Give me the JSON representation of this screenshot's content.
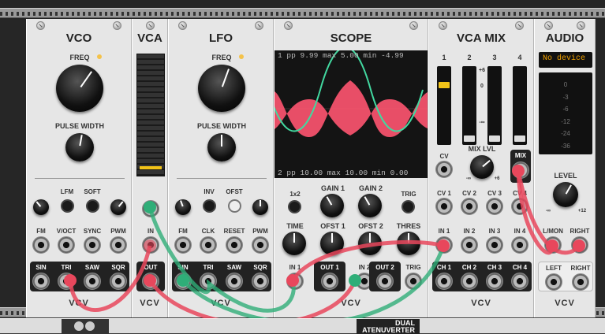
{
  "modules": {
    "vco": {
      "title": "VCO",
      "freq_label": "FREQ",
      "pw_label": "PULSE WIDTH",
      "lfm_label": "LFM",
      "soft_label": "SOFT",
      "inputs": [
        "FM",
        "V/OCT",
        "SYNC",
        "PWM"
      ],
      "outputs": [
        "SIN",
        "TRI",
        "SAW",
        "SQR"
      ],
      "brand": "VCV"
    },
    "vca": {
      "title": "VCA",
      "in_label": "IN",
      "out_label": "OUT",
      "brand": "VCV"
    },
    "lfo": {
      "title": "LFO",
      "freq_label": "FREQ",
      "pw_label": "PULSE WIDTH",
      "inv_label": "INV",
      "ofst_label": "OFST",
      "inputs": [
        "FM",
        "CLK",
        "RESET",
        "PWM"
      ],
      "outputs": [
        "SIN",
        "TRI",
        "SAW",
        "SQR"
      ],
      "brand": "VCV"
    },
    "scope": {
      "title": "SCOPE",
      "top_readout": {
        "channel": "1",
        "pp": "pp",
        "pp_val": "9.99",
        "max": "max",
        "max_val": "5.00",
        "min": "min",
        "min_val": "-4.99"
      },
      "bottom_readout": {
        "channel": "2",
        "pp": "pp",
        "pp_val": "10.00",
        "max": "max",
        "max_val": "10.00",
        "min": "min",
        "min_val": "0.00"
      },
      "x12_label": "1x2",
      "gain1": "GAIN 1",
      "gain2": "GAIN 2",
      "trig_label": "TRIG",
      "time_label": "TIME",
      "ofst1": "OFST 1",
      "ofst2": "OFST 2",
      "thres_label": "THRES",
      "ports": [
        "IN 1",
        "OUT 1",
        "IN 2",
        "OUT 2"
      ],
      "trig_in": "TRIG",
      "brand": "VCV"
    },
    "vcamix": {
      "title": "VCA MIX",
      "channels": [
        "1",
        "2",
        "3",
        "4"
      ],
      "scale_marks": [
        "+6",
        "0",
        "-∞"
      ],
      "cv_label": "CV",
      "mix_lvl_label": "MIX LVL",
      "mix_label": "MIX",
      "knob_min": "-∞",
      "knob_max": "+6",
      "cv_inputs": [
        "CV 1",
        "CV 2",
        "CV 3",
        "CV 4"
      ],
      "ins": [
        "IN 1",
        "IN 2",
        "IN 3",
        "IN 4"
      ],
      "outs": [
        "CH 1",
        "CH 2",
        "CH 3",
        "CH 4"
      ],
      "brand": "VCV"
    },
    "audio": {
      "title": "AUDIO",
      "device": "No device",
      "meter": [
        "0",
        "-3",
        "-6",
        "-12",
        "-24",
        "-36"
      ],
      "level_label": "LEVEL",
      "knob_min": "-∞",
      "knob_max": "+12",
      "inputs": [
        "L/MON",
        "RIGHT"
      ],
      "outputs": [
        "LEFT",
        "RIGHT"
      ],
      "brand": "VCV"
    }
  },
  "bottom_module": {
    "line1": "DUAL",
    "line2": "ATENUVERTER"
  },
  "colors": {
    "cable_red": "#e8475c",
    "cable_green": "#2fae78",
    "scope_green": "#42d8a0",
    "scope_pink": "#ff5470"
  }
}
